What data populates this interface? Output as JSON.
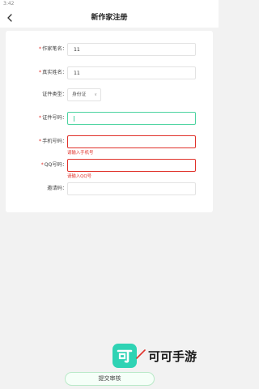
{
  "status_bar": {
    "time": "3:42"
  },
  "nav": {
    "title": "新作家注册"
  },
  "form": {
    "pen_name": {
      "star": "*",
      "label": "作家笔名：",
      "value": "11"
    },
    "real_name": {
      "star": "*",
      "label": "真实姓名：",
      "value": "11"
    },
    "id_type": {
      "label": "证件类型：",
      "value": "身份证"
    },
    "id_number": {
      "star": "*",
      "label": "证件号码：",
      "value": ""
    },
    "phone": {
      "star": "*",
      "label": "手机号码：",
      "value": "",
      "error": "请输入手机号"
    },
    "qq": {
      "star": "*",
      "label": "QQ号码：",
      "value": "",
      "error": "请输入QQ号"
    },
    "invite": {
      "label": "邀请码：",
      "value": ""
    }
  },
  "watermark": {
    "text": "可可手游"
  },
  "submit": {
    "label": "提交审核"
  },
  "colors": {
    "accent": "#4cd3a0",
    "error": "#e0322b",
    "logo": "#2fd3b4"
  }
}
